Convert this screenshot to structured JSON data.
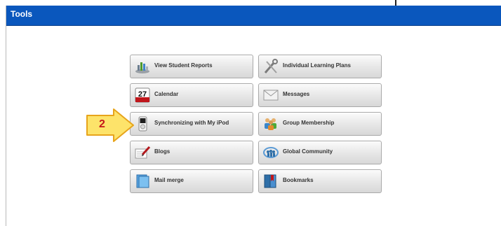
{
  "panel": {
    "title": "Tools"
  },
  "buttons": {
    "left": [
      {
        "label": "View Student Reports",
        "icon": "bar-chart-icon"
      },
      {
        "label": "Calendar",
        "icon": "calendar-icon",
        "date": "27"
      },
      {
        "label": "Synchronizing with My iPod",
        "icon": "ipod-icon"
      },
      {
        "label": "Blogs",
        "icon": "blog-pencil-icon"
      },
      {
        "label": "Mail merge",
        "icon": "mail-merge-icon"
      }
    ],
    "right": [
      {
        "label": "Individual Learning Plans",
        "icon": "tools-icon"
      },
      {
        "label": "Messages",
        "icon": "envelope-icon"
      },
      {
        "label": "Group Membership",
        "icon": "group-people-icon"
      },
      {
        "label": "Global Community",
        "icon": "global-community-icon"
      },
      {
        "label": "Bookmarks",
        "icon": "bookmark-book-icon"
      }
    ]
  },
  "callout": {
    "number": "2"
  },
  "colors": {
    "titlebar": "#0a57bd",
    "callout_fill": "#fde36a",
    "callout_border": "#e7a41b",
    "callout_text": "#c5161a"
  }
}
